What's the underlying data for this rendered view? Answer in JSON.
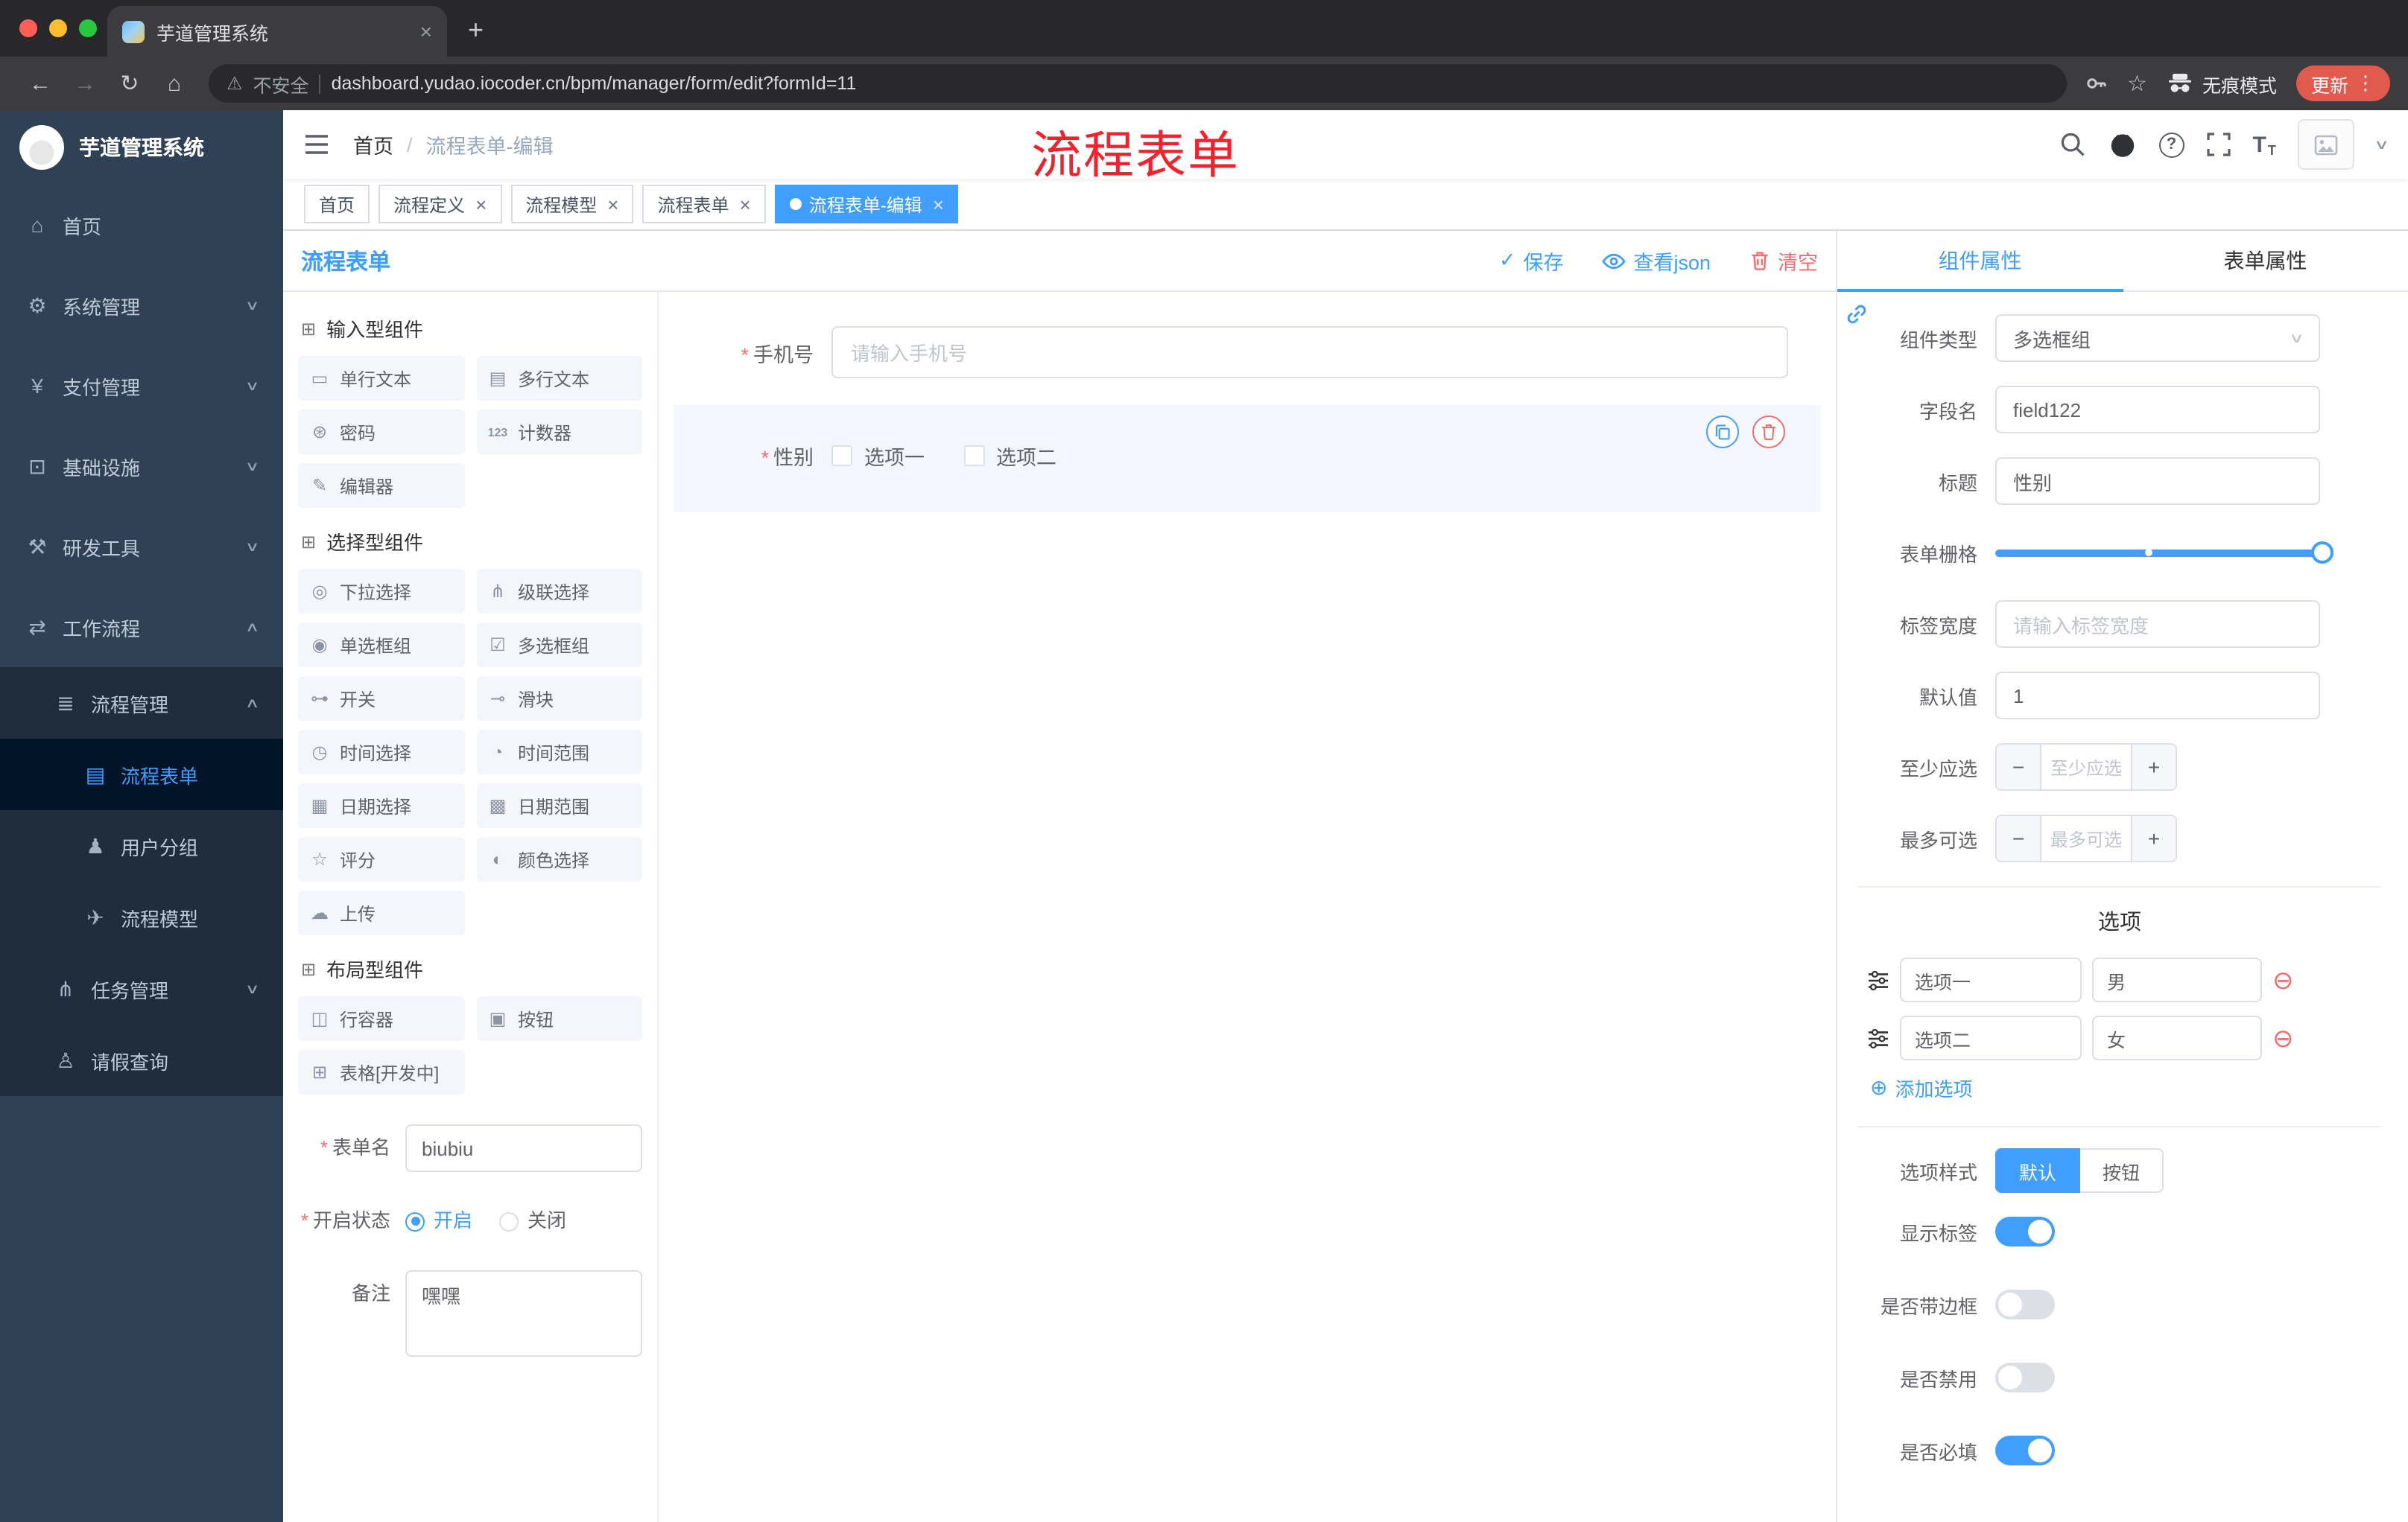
{
  "colors": {
    "primary": "#409eff",
    "danger": "#f56c6c",
    "annotation_red": "#f5222d",
    "sidebar_bg": "#304156",
    "update_button": "#e2594e",
    "active_tag": "#409eff"
  },
  "browser": {
    "tab_title": "芋道管理系统",
    "security_label": "不安全",
    "url": "dashboard.yudao.iocoder.cn/bpm/manager/form/edit?formId=11",
    "incognito_label": "无痕模式",
    "update_label": "更新"
  },
  "sidebar": {
    "logo_title": "芋道管理系统",
    "items": [
      {
        "icon": "⌂",
        "label": "首页"
      },
      {
        "icon": "⚙",
        "label": "系统管理",
        "chevron": "∨"
      },
      {
        "icon": "¥",
        "label": "支付管理",
        "chevron": "∨"
      },
      {
        "icon": "⊡",
        "label": "基础设施",
        "chevron": "∨"
      },
      {
        "icon": "⚒",
        "label": "研发工具",
        "chevron": "∨"
      },
      {
        "icon": "⇄",
        "label": "工作流程",
        "chevron": "∧"
      },
      {
        "icon": "≣",
        "label": "流程管理",
        "chevron": "∧"
      },
      {
        "icon": "▤",
        "label": "流程表单"
      },
      {
        "icon": "♟",
        "label": "用户分组"
      },
      {
        "icon": "✈",
        "label": "流程模型"
      },
      {
        "icon": "⋔",
        "label": "任务管理",
        "chevron": "∨"
      },
      {
        "icon": "♙",
        "label": "请假查询"
      }
    ]
  },
  "navbar": {
    "breadcrumb": {
      "home": "首页",
      "separator": "/",
      "current": "流程表单-编辑"
    },
    "annotation": "流程表单"
  },
  "tags": [
    {
      "label": "首页"
    },
    {
      "label": "流程定义"
    },
    {
      "label": "流程模型"
    },
    {
      "label": "流程表单"
    },
    {
      "label": "流程表单-编辑"
    }
  ],
  "designer": {
    "title": "流程表单",
    "save_label": "保存",
    "view_json_label": "查看json",
    "clear_label": "清空",
    "required_mark": "*"
  },
  "palette": {
    "sections": [
      {
        "title": "输入型组件",
        "items": [
          {
            "icon": "▭",
            "label": "单行文本"
          },
          {
            "icon": "▤",
            "label": "多行文本"
          },
          {
            "icon": "⊛",
            "label": "密码"
          },
          {
            "icon": "123",
            "label": "计数器"
          },
          {
            "icon": "✎",
            "label": "编辑器"
          }
        ]
      },
      {
        "title": "选择型组件",
        "items": [
          {
            "icon": "◎",
            "label": "下拉选择"
          },
          {
            "icon": "⋔",
            "label": "级联选择"
          },
          {
            "icon": "◉",
            "label": "单选框组"
          },
          {
            "icon": "☑",
            "label": "多选框组"
          },
          {
            "icon": "⊶",
            "label": "开关"
          },
          {
            "icon": "⊸",
            "label": "滑块"
          },
          {
            "icon": "◷",
            "label": "时间选择"
          },
          {
            "icon": "◔",
            "label": "时间范围"
          },
          {
            "icon": "▦",
            "label": "日期选择"
          },
          {
            "icon": "▩",
            "label": "日期范围"
          },
          {
            "icon": "☆",
            "label": "评分"
          },
          {
            "icon": "◐",
            "label": "颜色选择"
          },
          {
            "icon": "☁",
            "label": "上传"
          }
        ]
      },
      {
        "title": "布局型组件",
        "items": [
          {
            "icon": "◫",
            "label": "行容器"
          },
          {
            "icon": "▣",
            "label": "按钮"
          },
          {
            "icon": "⊞",
            "label": "表格[开发中]"
          }
        ]
      }
    ]
  },
  "form_meta": {
    "name_label": "表单名",
    "name_value": "biubiu",
    "status_label": "开启状态",
    "status_on": "开启",
    "status_off": "关闭",
    "status_selected": "开启",
    "remark_label": "备注",
    "remark_value": "嘿嘿"
  },
  "canvas": {
    "phone": {
      "label": "手机号",
      "placeholder": "请输入手机号"
    },
    "gender": {
      "label": "性别",
      "option1": "选项一",
      "option2": "选项二"
    }
  },
  "props": {
    "tab_component": "组件属性",
    "tab_form": "表单属性",
    "active_tab": "组件属性",
    "rows": {
      "component_type": {
        "label": "组件类型",
        "value": "多选框组"
      },
      "field_name": {
        "label": "字段名",
        "value": "field122"
      },
      "title": {
        "label": "标题",
        "value": "性别"
      },
      "grid": {
        "label": "表单栅格",
        "value": 24,
        "stop_percent": 46
      },
      "label_width": {
        "label": "标签宽度",
        "placeholder": "请输入标签宽度"
      },
      "default_value": {
        "label": "默认值",
        "value": "1"
      },
      "min_select": {
        "label": "至少应选",
        "placeholder": "至少应选"
      },
      "max_select": {
        "label": "最多可选",
        "placeholder": "最多可选"
      }
    },
    "options_title": "选项",
    "options": [
      {
        "label": "选项一",
        "value": "男"
      },
      {
        "label": "选项二",
        "value": "女"
      }
    ],
    "add_option_label": "添加选项",
    "option_style": {
      "label": "选项样式",
      "default": "默认",
      "button": "按钮",
      "selected": "默认"
    },
    "switches": [
      {
        "label": "显示标签",
        "on": true
      },
      {
        "label": "是否带边框",
        "on": false
      },
      {
        "label": "是否禁用",
        "on": false
      },
      {
        "label": "是否必填",
        "on": true
      }
    ]
  }
}
